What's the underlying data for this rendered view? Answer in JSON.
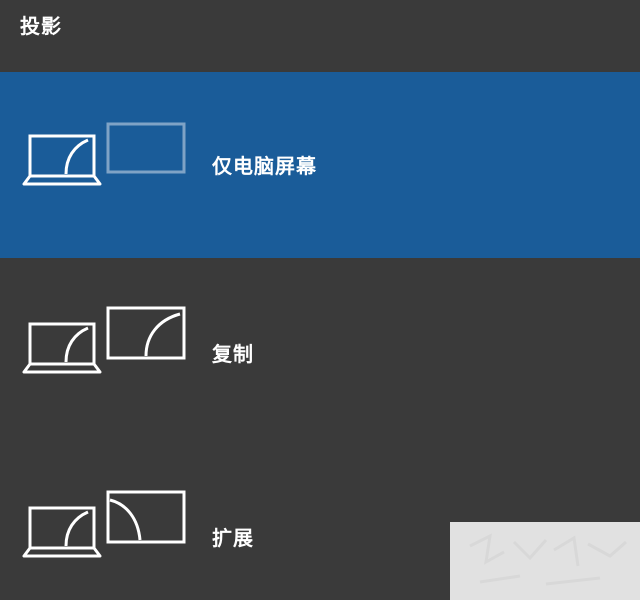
{
  "panel": {
    "title": "投影"
  },
  "options": [
    {
      "label": "仅电脑屏幕",
      "icon": "pc-screen-only-icon",
      "selected": true
    },
    {
      "label": "复制",
      "icon": "duplicate-icon",
      "selected": false
    },
    {
      "label": "扩展",
      "icon": "extend-icon",
      "selected": false
    }
  ],
  "colors": {
    "background": "#3a3a3a",
    "selected": "#1a5c99",
    "foreground": "#ffffff",
    "dim_screen": "#7fa3c6"
  }
}
